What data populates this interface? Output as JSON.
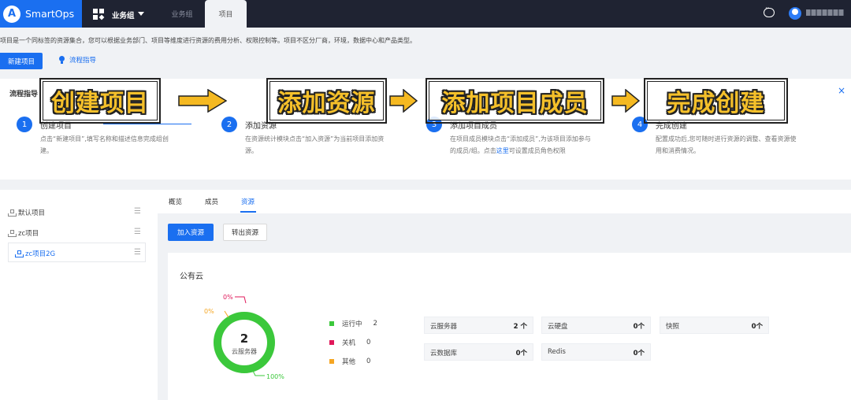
{
  "brand": {
    "logo": "A",
    "name": "SmartOps"
  },
  "topnav": {
    "group_label": "业务组",
    "tabs": [
      {
        "label": "业务组"
      },
      {
        "label": "项目"
      }
    ]
  },
  "intro": {
    "description": "项目是一个同标签的资源集合，您可以根据业务部门、项目等维度进行资源的费用分析、权限控制等。项目不区分厂商，环境，数据中心和产品类型。",
    "new_button": "新建项目",
    "guide_link": "流程指导"
  },
  "guide": {
    "title": "流程指导",
    "close": "×",
    "steps": [
      {
        "num": "1",
        "title": "创建项目",
        "desc": "点击“新建项目”,填写名称和描述信息完成组创建。"
      },
      {
        "num": "2",
        "title": "添加资源",
        "desc": "在资源统计模块点击“加入资源”为当前项目添加资源。"
      },
      {
        "num": "3",
        "title": "添加项目成员",
        "desc_pre": "在项目成员模块点击“添加成员”,为该项目添加参与的成员/组。点击",
        "desc_link": "这里",
        "desc_post": "可设置成员角色权限"
      },
      {
        "num": "4",
        "title": "完成创建",
        "desc": "配置成功后,您可随时进行资源的调整、查看资源使用和消费情况。"
      }
    ],
    "banners": [
      "创建项目",
      "添加资源",
      "添加项目成员",
      "完成创建"
    ]
  },
  "sidebar": {
    "items": [
      {
        "label": "默认项目"
      },
      {
        "label": "zc项目"
      },
      {
        "label": "zc项目2G"
      }
    ],
    "menu_glyph": "☰"
  },
  "main": {
    "tabs": [
      {
        "label": "概览"
      },
      {
        "label": "成员"
      },
      {
        "label": "资源"
      }
    ],
    "add_button": "加入资源",
    "transfer_button": "转出资源",
    "panel_title": "公有云",
    "donut": {
      "center_value": "2",
      "center_label": "云服务器",
      "labels": [
        "0%",
        "0%",
        "100%"
      ],
      "running_fraction": 1.0,
      "colors": {
        "running": "#3bc83b",
        "stopped": "#e0185a",
        "other": "#f5a623"
      }
    },
    "legend": [
      {
        "label": "运行中",
        "value": "2",
        "color": "#3bc83b"
      },
      {
        "label": "关机",
        "value": "0",
        "color": "#e0185a"
      },
      {
        "label": "其他",
        "value": "0",
        "color": "#f5a623"
      }
    ],
    "resources": [
      {
        "label": "云服务器",
        "value": "2 个"
      },
      {
        "label": "云硬盘",
        "value": "0个"
      },
      {
        "label": "快照",
        "value": "0个"
      },
      {
        "label": "云数据库",
        "value": "0个"
      },
      {
        "label": "Redis",
        "value": "0个"
      }
    ]
  },
  "colors": {
    "accent": "#1a6ff0",
    "topbar": "#1f2332",
    "banner_text": "#f5c02a"
  }
}
